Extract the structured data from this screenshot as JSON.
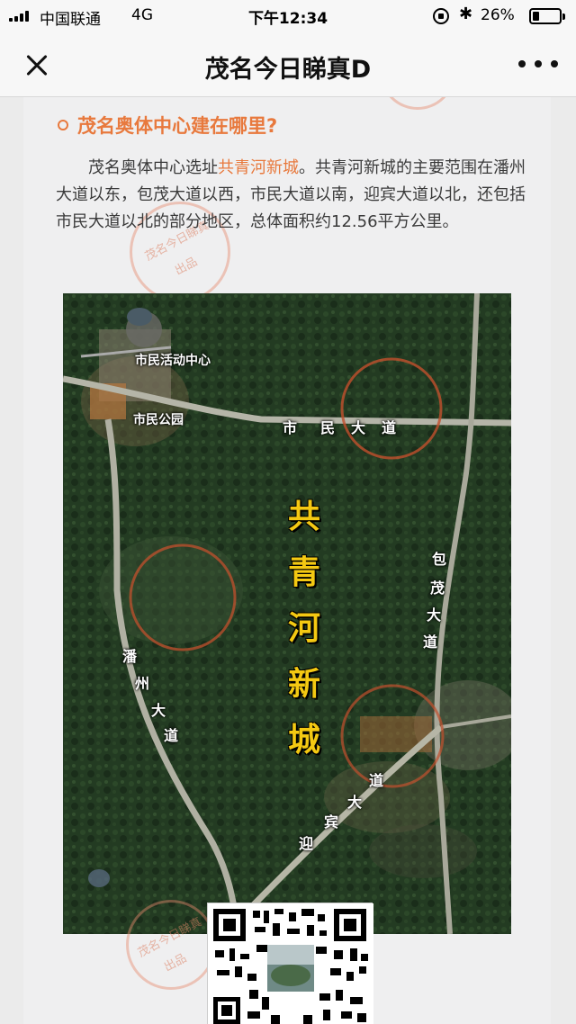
{
  "status_bar": {
    "carrier": "中国联通",
    "network": "4G",
    "time": "下午12:34",
    "battery_percent": "26%",
    "battery_level": 0.26
  },
  "nav": {
    "title": "茂名今日睇真D"
  },
  "article": {
    "section_title": "茂名奥体中心建在哪里?",
    "paragraph_before": "茂名奥体中心选址",
    "paragraph_highlight": "共青河新城",
    "paragraph_after": "。共青河新城的主要范围在潘州大道以东，包茂大道以西，市民大道以南，迎宾大道以北，还包括市民大道以北的部分地区，总体面积约12.56平方公里。",
    "watermark_line1": "茂名今日睇真",
    "watermark_line2": "出品"
  },
  "map": {
    "labels": {
      "civic_center": "市民活动中心",
      "civic_park": "市民公园"
    },
    "roads": {
      "shimin": [
        "市",
        "民",
        "大",
        "道"
      ],
      "baomao": [
        "包",
        "茂",
        "大",
        "道"
      ],
      "panzhou": [
        "潘",
        "州",
        "大",
        "道"
      ],
      "yingbin": [
        "迎",
        "宾",
        "大",
        "道"
      ]
    },
    "district_name": [
      "共",
      "青",
      "河",
      "新",
      "城"
    ]
  },
  "colors": {
    "accent": "#e8793d",
    "district_text": "#f4c912"
  },
  "icons": {
    "close": "close-icon",
    "more": "more-icon",
    "bluetooth": "bluetooth-icon",
    "orientation_lock": "orientation-lock-icon"
  }
}
